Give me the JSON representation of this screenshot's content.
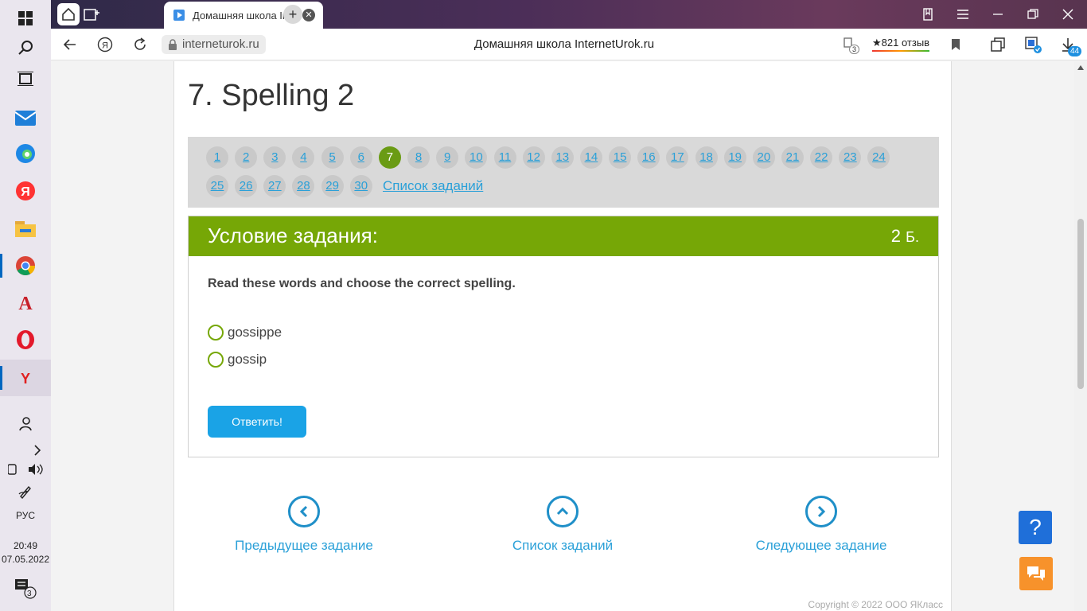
{
  "taskbar": {
    "language": "РУС",
    "time": "20:49",
    "date": "07.05.2022",
    "notifications_badge": "3"
  },
  "browser": {
    "tab_title": "Домашняя школа InternetUrok.ru",
    "url": "interneturok.ru",
    "page_title": "Домашняя школа InternetUrok.ru",
    "protect_badge": "3",
    "reviews": "★821 отзыв",
    "downloads_badge": "44"
  },
  "page": {
    "heading": "7. Spelling 2",
    "pages": [
      "1",
      "2",
      "3",
      "4",
      "5",
      "6",
      "7",
      "8",
      "9",
      "10",
      "11",
      "12",
      "13",
      "14",
      "15",
      "16",
      "17",
      "18",
      "19",
      "20",
      "21",
      "22",
      "23",
      "24",
      "25",
      "26",
      "27",
      "28",
      "29",
      "30"
    ],
    "active_page": "7",
    "task_list_link": "Список заданий",
    "task": {
      "title": "Условие задания:",
      "points_value": "2",
      "points_unit": "Б.",
      "question": "Read these words and choose the correct spelling.",
      "options": [
        "gossippe",
        "gossip"
      ],
      "answer_button": "Ответить!"
    },
    "nav": {
      "prev": "Предыдущее задание",
      "list": "Список заданий",
      "next": "Следующее задание"
    },
    "copyright": "Copyright © 2022 ООО ЯКласс",
    "help_label": "?"
  },
  "colors": {
    "accent_green": "#76a706",
    "active_page": "#6a9b14",
    "link_blue": "#2aa0d8",
    "button_blue": "#1aa3e6",
    "help_blue": "#1f6fd9",
    "chat_orange": "#f7922b"
  }
}
